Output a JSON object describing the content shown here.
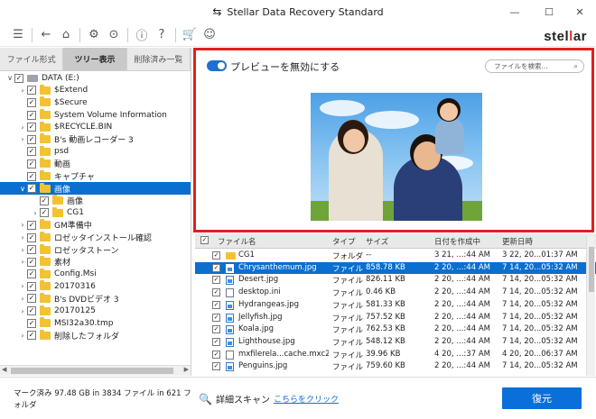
{
  "window": {
    "title": "Stellar Data Recovery Standard",
    "title_icon": "back-arrow-icon",
    "controls": {
      "minimize": "—",
      "maximize": "☐",
      "close": "✕"
    }
  },
  "toolbar": {
    "brand_left": "stel",
    "brand_accent": "l",
    "brand_right": "ar",
    "icons": [
      "hamburger-menu-icon",
      "back-icon",
      "home-icon",
      "settings-icon",
      "resume-icon",
      "info-icon",
      "help-icon",
      "cart-icon",
      "account-icon"
    ]
  },
  "tabs": [
    {
      "label": "ファイル形式",
      "active": false
    },
    {
      "label": "ツリー表示",
      "active": true
    },
    {
      "label": "削除済み一覧",
      "active": false
    }
  ],
  "tree": [
    {
      "label": "DATA (E:)",
      "level": 0,
      "expander": "∨",
      "type": "drive",
      "selected": false
    },
    {
      "label": "$Extend",
      "level": 1,
      "expander": "›",
      "type": "folder",
      "selected": false
    },
    {
      "label": "$Secure",
      "level": 1,
      "expander": "",
      "type": "folder",
      "selected": false
    },
    {
      "label": "System Volume Information",
      "level": 1,
      "expander": "",
      "type": "folder",
      "selected": false
    },
    {
      "label": "$RECYCLE.BIN",
      "level": 1,
      "expander": "›",
      "type": "folder",
      "selected": false
    },
    {
      "label": "B's 動画レコーダー 3",
      "level": 1,
      "expander": "›",
      "type": "folder",
      "selected": false
    },
    {
      "label": "psd",
      "level": 1,
      "expander": "",
      "type": "folder",
      "selected": false
    },
    {
      "label": "動画",
      "level": 1,
      "expander": "",
      "type": "folder",
      "selected": false
    },
    {
      "label": "キャプチャ",
      "level": 1,
      "expander": "",
      "type": "folder",
      "selected": false
    },
    {
      "label": "画像",
      "level": 1,
      "expander": "∨",
      "type": "folder",
      "selected": true
    },
    {
      "label": "画像",
      "level": 2,
      "expander": "",
      "type": "folder",
      "selected": false
    },
    {
      "label": "CG1",
      "level": 2,
      "expander": "›",
      "type": "folder",
      "selected": false
    },
    {
      "label": "GM準備中",
      "level": 1,
      "expander": "›",
      "type": "folder",
      "selected": false
    },
    {
      "label": "ロゼッタインストール確認",
      "level": 1,
      "expander": "›",
      "type": "folder",
      "selected": false
    },
    {
      "label": "ロゼッタストーン",
      "level": 1,
      "expander": "›",
      "type": "folder",
      "selected": false
    },
    {
      "label": "素材",
      "level": 1,
      "expander": "›",
      "type": "folder",
      "selected": false
    },
    {
      "label": "Config.Msi",
      "level": 1,
      "expander": "",
      "type": "folder",
      "selected": false
    },
    {
      "label": "20170316",
      "level": 1,
      "expander": "›",
      "type": "folder",
      "selected": false
    },
    {
      "label": "B's DVDビデオ 3",
      "level": 1,
      "expander": "›",
      "type": "folder",
      "selected": false
    },
    {
      "label": "20170125",
      "level": 1,
      "expander": "›",
      "type": "folder",
      "selected": false
    },
    {
      "label": "MSI32a30.tmp",
      "level": 1,
      "expander": "",
      "type": "folder",
      "selected": false
    },
    {
      "label": "削除したフォルダ",
      "level": 1,
      "expander": "›",
      "type": "folder",
      "selected": false
    }
  ],
  "preview": {
    "toggle_label": "プレビューを無効にする",
    "toggle_on": true,
    "search_placeholder": "ファイルを検索...",
    "search_icon": "search-icon"
  },
  "files": {
    "columns": [
      "ファイル名",
      "タイプ",
      "サイズ",
      "日付を作成中",
      "更新日時"
    ],
    "rows": [
      {
        "name": "CG1",
        "type": "フォルダ",
        "size": "--",
        "created": "3 21, ...:44 AM",
        "modified": "3 22, 20...01:37 AM",
        "icon": "folder",
        "selected": false
      },
      {
        "name": "Chrysanthemum.jpg",
        "type": "ファイル",
        "size": "858.78 KB",
        "created": "2 20, ...:44 AM",
        "modified": "7 14, 20...05:32 AM",
        "icon": "img",
        "selected": true
      },
      {
        "name": "Desert.jpg",
        "type": "ファイル",
        "size": "826.11 KB",
        "created": "2 20, ...:44 AM",
        "modified": "7 14, 20...05:32 AM",
        "icon": "img",
        "selected": false
      },
      {
        "name": "desktop.ini",
        "type": "ファイル",
        "size": "0.46 KB",
        "created": "2 20, ...:44 AM",
        "modified": "7 14, 20...05:32 AM",
        "icon": "file",
        "selected": false
      },
      {
        "name": "Hydrangeas.jpg",
        "type": "ファイル",
        "size": "581.33 KB",
        "created": "2 20, ...:44 AM",
        "modified": "7 14, 20...05:32 AM",
        "icon": "img",
        "selected": false
      },
      {
        "name": "Jellyfish.jpg",
        "type": "ファイル",
        "size": "757.52 KB",
        "created": "2 20, ...:44 AM",
        "modified": "7 14, 20...05:32 AM",
        "icon": "img",
        "selected": false
      },
      {
        "name": "Koala.jpg",
        "type": "ファイル",
        "size": "762.53 KB",
        "created": "2 20, ...:44 AM",
        "modified": "7 14, 20...05:32 AM",
        "icon": "img",
        "selected": false
      },
      {
        "name": "Lighthouse.jpg",
        "type": "ファイル",
        "size": "548.12 KB",
        "created": "2 20, ...:44 AM",
        "modified": "7 14, 20...05:32 AM",
        "icon": "img",
        "selected": false
      },
      {
        "name": "mxfilerela...cache.mxc2",
        "type": "ファイル",
        "size": "39.96 KB",
        "created": "4 20, ...:37 AM",
        "modified": "4 20, 20...06:37 AM",
        "icon": "file",
        "selected": false
      },
      {
        "name": "Penguins.jpg",
        "type": "ファイル",
        "size": "759.60 KB",
        "created": "2 20, ...:44 AM",
        "modified": "7 14, 20...05:32 AM",
        "icon": "img",
        "selected": false
      }
    ]
  },
  "bottom": {
    "status_text": "マーク済み 97.48 GB in 3834 ファイル in 621 フォルダ",
    "scan_label": "詳細スキャン",
    "scan_link": "こちらをクリック",
    "restore_label": "復元"
  },
  "colors": {
    "accent": "#0a6fd8",
    "highlight_border": "#e02020",
    "brand_accent": "#e0302b",
    "selected_row": "#0a6fcf"
  }
}
